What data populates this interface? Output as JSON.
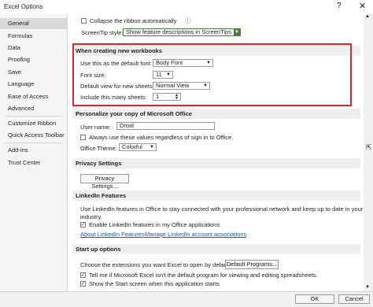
{
  "window": {
    "title": "Excel Options",
    "help": "?",
    "close": "✕"
  },
  "sidebar": {
    "items": [
      "General",
      "Formulas",
      "Data",
      "Proofing",
      "Save",
      "Language",
      "Ease of Access",
      "Advanced",
      "Customize Ribbon",
      "Quick Access Toolbar",
      "Add-ins",
      "Trust Center"
    ],
    "active": "General"
  },
  "ui_options": {
    "collapse_ribbon_label": "Collapse the ribbon automatically",
    "screentip_label": "ScreenTip style:",
    "screentip_value": "Show feature descriptions in ScreenTips"
  },
  "new_workbooks": {
    "header": "When creating new workbooks",
    "font_label": "Use this as the default font:",
    "font_value": "Body Font",
    "size_label": "Font size:",
    "size_value": "11",
    "view_label": "Default view for new sheets:",
    "view_value": "Normal View",
    "sheets_label": "Include this many sheets:",
    "sheets_value": "1"
  },
  "personalize": {
    "header": "Personalize your copy of Microsoft Office",
    "username_label": "User name:",
    "username_value": "Droid",
    "always_use_label": "Always use these values regardless of sign in to Office.",
    "theme_label": "Office Theme:",
    "theme_value": "Colorful"
  },
  "privacy": {
    "header": "Privacy Settings",
    "button": "Privacy Settings..."
  },
  "linkedin": {
    "header": "LinkedIn Features",
    "desc1": "Use LinkedIn features in Office to stay connected with your professional network and keep up to date in your",
    "desc2": "industry.",
    "enable_label": "Enable LinkedIn features in my Office applications",
    "about_link": "About LinkedIn Features",
    "manage_link": "Manage LinkedIn account associations"
  },
  "startup": {
    "header": "Start up options",
    "choose_label": "Choose the extensions you want Excel to open by default:",
    "default_programs_button": "Default Programs...",
    "tell_me_label": "Tell me if Microsoft Excel isn't the default program for viewing and editing spreadsheets.",
    "start_screen_label": "Show the Start screen when this application starts"
  },
  "footer": {
    "ok": "OK",
    "cancel": "Cancel"
  }
}
